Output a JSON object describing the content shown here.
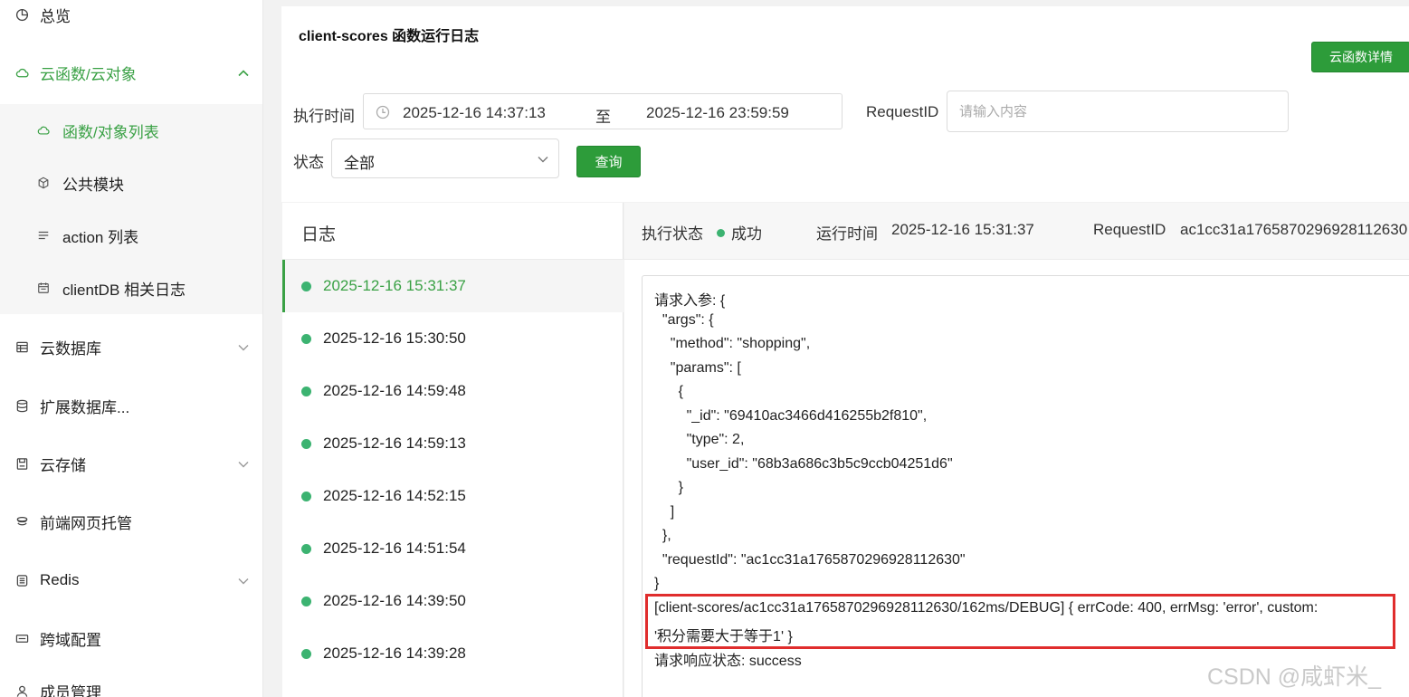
{
  "sidebar": {
    "items": [
      {
        "label": "总览",
        "icon": "pie-chart-icon"
      },
      {
        "label": "云函数/云对象",
        "icon": "cloud-icon",
        "expanded": true
      },
      {
        "label": "云数据库",
        "icon": "database-table-icon"
      },
      {
        "label": "扩展数据库...",
        "icon": "database-icon"
      },
      {
        "label": "云存储",
        "icon": "storage-icon"
      },
      {
        "label": "前端网页托管",
        "icon": "hosting-icon"
      },
      {
        "label": "Redis",
        "icon": "redis-icon"
      },
      {
        "label": "跨域配置",
        "icon": "cross-domain-icon"
      },
      {
        "label": "成员管理",
        "icon": "user-icon"
      }
    ],
    "sub_items": [
      {
        "label": "函数/对象列表",
        "icon": "cloud-icon",
        "active": true
      },
      {
        "label": "公共模块",
        "icon": "cube-icon"
      },
      {
        "label": "action 列表",
        "icon": "list-icon"
      },
      {
        "label": "clientDB 相关日志",
        "icon": "calendar-icon"
      }
    ]
  },
  "header": {
    "title": "client-scores 函数运行日志",
    "detail_button": "云函数详情"
  },
  "filters": {
    "time_label": "执行时间",
    "start_time": "2025-12-16 14:37:13",
    "range_sep": "至",
    "end_time": "2025-12-16 23:59:59",
    "request_label": "RequestID",
    "request_placeholder": "请输入内容",
    "status_label": "状态",
    "status_value": "全部",
    "query_button": "查询"
  },
  "logs": {
    "header": "日志",
    "entries": [
      "2025-12-16 15:31:37",
      "2025-12-16 15:30:50",
      "2025-12-16 14:59:48",
      "2025-12-16 14:59:13",
      "2025-12-16 14:52:15",
      "2025-12-16 14:51:54",
      "2025-12-16 14:39:50",
      "2025-12-16 14:39:28"
    ],
    "active_index": 0
  },
  "detail": {
    "status_label": "执行状态",
    "status_value": "成功",
    "run_time_label": "运行时间",
    "run_time_value": "2025-12-16 15:31:37",
    "request_id_label": "RequestID",
    "request_id_value": "ac1cc31a1765870296928112630",
    "lines": [
      "请求入参: {",
      "  \"args\": {",
      "    \"method\": \"shopping\",",
      "    \"params\": [",
      "      {",
      "        \"_id\": \"69410ac3466d416255b2f810\",",
      "        \"type\": 2,",
      "        \"user_id\": \"68b3a686c3b5c9ccb04251d6\"",
      "      }",
      "    ]",
      "  },",
      "  \"requestId\": \"ac1cc31a1765870296928112630\"",
      "}",
      "[client-scores/ac1cc31a1765870296928112630/162ms/DEBUG] { errCode: 400, errMsg: 'error', custom:",
      "'积分需要大于等于1' }",
      "请求响应状态: success"
    ]
  },
  "watermark": "CSDN @咸虾米_",
  "colors": {
    "accent": "#3aa145",
    "button": "#2d9c3a",
    "highlight": "#e02d2d"
  }
}
